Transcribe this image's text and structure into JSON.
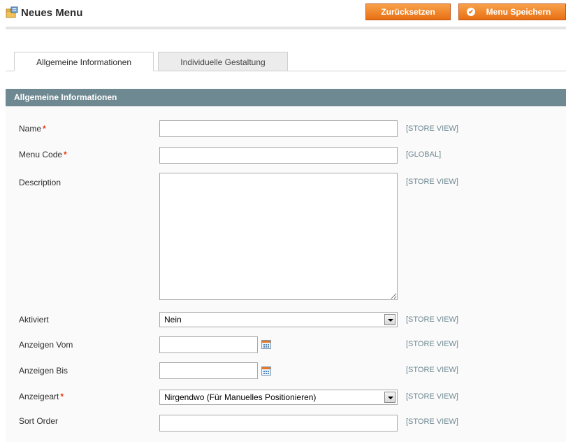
{
  "header": {
    "title": "Neues Menu",
    "icon": "menu-folder-icon",
    "reset_label": "Zurücksetzen",
    "save_label": "Menu Speichern",
    "accent_color": "#e86e12"
  },
  "tabs": [
    {
      "label": "Allgemeine Informationen",
      "active": true
    },
    {
      "label": "Individuelle Gestaltung",
      "active": false
    }
  ],
  "section": {
    "title": "Allgemeine Informationen",
    "header_color": "#6f8992"
  },
  "fields": {
    "name": {
      "label": "Name",
      "required": "*",
      "value": "",
      "scope": "[STORE VIEW]"
    },
    "menu_code": {
      "label": "Menu Code",
      "required": "*",
      "value": "",
      "scope": "[GLOBAL]"
    },
    "description": {
      "label": "Description",
      "value": "",
      "scope": "[STORE VIEW]"
    },
    "aktiviert": {
      "label": "Aktiviert",
      "selected": "Nein",
      "scope": "[STORE VIEW]"
    },
    "anzeigen_vom": {
      "label": "Anzeigen Vom",
      "value": "",
      "scope": "[STORE VIEW]"
    },
    "anzeigen_bis": {
      "label": "Anzeigen Bis",
      "value": "",
      "scope": "[STORE VIEW]"
    },
    "anzeigeart": {
      "label": "Anzeigeart",
      "required": "*",
      "selected": "Nirgendwo (Für Manuelles Positionieren)",
      "scope": "[STORE VIEW]"
    },
    "sort_order": {
      "label": "Sort Order",
      "value": "",
      "scope": "[STORE VIEW]"
    }
  }
}
